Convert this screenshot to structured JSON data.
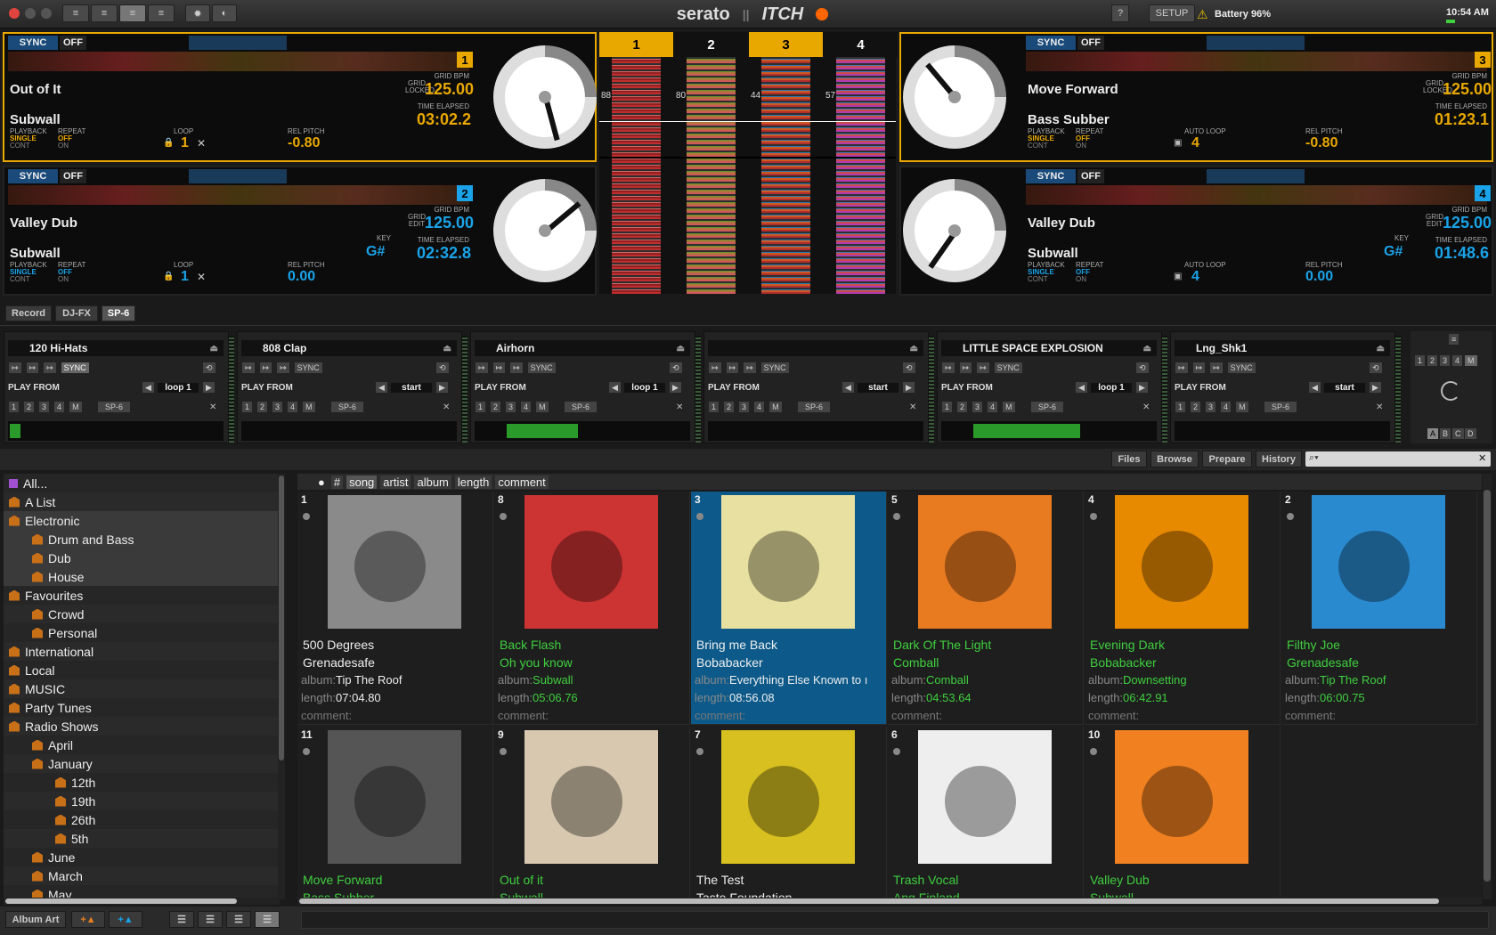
{
  "top": {
    "brand": "serato",
    "brand2": "ITCH",
    "help": "?",
    "setup": "SETUP",
    "battery": "Battery 96%",
    "time": "10:54 AM"
  },
  "decks": [
    {
      "no": "1",
      "sync": "SYNC",
      "off": "OFF",
      "title": "Out of It",
      "artist": "Subwall",
      "grid_lbl": "GRID LOCKED",
      "bpm_lbl": "GRID BPM",
      "bpm": "125.00",
      "time_lbl": "TIME ELAPSED",
      "time": "03:02.2",
      "playback_lbl": "PLAYBACK",
      "playback": "SINGLE",
      "playback2": "CONT",
      "repeat_lbl": "REPEAT",
      "repeat": "OFF",
      "repeat2": "ON",
      "loop_lbl": "LOOP",
      "loop": "1",
      "pitch_lbl": "REL PITCH",
      "pitch": "-0.80",
      "key_lbl": "",
      "key": ""
    },
    {
      "no": "2",
      "sync": "SYNC",
      "off": "OFF",
      "title": "Valley Dub",
      "artist": "Subwall",
      "grid_lbl": "GRID EDIT",
      "bpm_lbl": "GRID BPM",
      "bpm": "125.00",
      "time_lbl": "TIME ELAPSED",
      "time": "02:32.8",
      "playback_lbl": "PLAYBACK",
      "playback": "SINGLE",
      "playback2": "CONT",
      "repeat_lbl": "REPEAT",
      "repeat": "OFF",
      "repeat2": "ON",
      "loop_lbl": "LOOP",
      "loop": "1",
      "pitch_lbl": "REL PITCH",
      "pitch": "0.00",
      "key_lbl": "KEY",
      "key": "G#"
    },
    {
      "no": "3",
      "sync": "SYNC",
      "off": "OFF",
      "title": "Move Forward",
      "artist": "Bass Subber",
      "grid_lbl": "GRID LOCKED",
      "bpm_lbl": "GRID BPM",
      "bpm": "125.00",
      "time_lbl": "TIME ELAPSED",
      "time": "01:23.1",
      "playback_lbl": "PLAYBACK",
      "playback": "SINGLE",
      "playback2": "CONT",
      "repeat_lbl": "REPEAT",
      "repeat": "OFF",
      "repeat2": "ON",
      "loop_lbl": "AUTO LOOP",
      "loop": "4",
      "pitch_lbl": "REL PITCH",
      "pitch": "-0.80",
      "key_lbl": "",
      "key": ""
    },
    {
      "no": "4",
      "sync": "SYNC",
      "off": "OFF",
      "title": "Valley Dub",
      "artist": "Subwall",
      "grid_lbl": "GRID EDIT",
      "bpm_lbl": "GRID BPM",
      "bpm": "125.00",
      "time_lbl": "TIME ELAPSED",
      "time": "01:48.6",
      "playback_lbl": "PLAYBACK",
      "playback": "SINGLE",
      "playback2": "CONT",
      "repeat_lbl": "REPEAT",
      "repeat": "OFF",
      "repeat2": "ON",
      "loop_lbl": "AUTO LOOP",
      "loop": "4",
      "pitch_lbl": "REL PITCH",
      "pitch": "0.00",
      "key_lbl": "KEY",
      "key": "G#"
    }
  ],
  "center": {
    "cols": [
      "1",
      "2",
      "3",
      "4"
    ],
    "bpms": [
      "88",
      "80",
      "44",
      "57"
    ]
  },
  "tabs": [
    "Record",
    "DJ-FX",
    "SP-6"
  ],
  "samples": [
    {
      "name": "120 Hi-Hats",
      "play_from": "PLAY FROM",
      "mode": "loop 1",
      "sync": "SYNC",
      "sp": "SP-6"
    },
    {
      "name": "808 Clap",
      "play_from": "PLAY FROM",
      "mode": "start",
      "sync": "SYNC",
      "sp": "SP-6"
    },
    {
      "name": "Airhorn",
      "play_from": "PLAY FROM",
      "mode": "loop 1",
      "sync": "SYNC",
      "sp": "SP-6"
    },
    {
      "name": "",
      "play_from": "PLAY FROM",
      "mode": "start",
      "sync": "SYNC",
      "sp": "SP-6"
    },
    {
      "name": "LITTLE SPACE EXPLOSION",
      "play_from": "PLAY FROM",
      "mode": "loop 1",
      "sync": "SYNC",
      "sp": "SP-6"
    },
    {
      "name": "Lng_Shk1",
      "play_from": "PLAY FROM",
      "mode": "start",
      "sync": "SYNC",
      "sp": "SP-6"
    }
  ],
  "slots": [
    "1",
    "2",
    "3",
    "4",
    "M"
  ],
  "bank": [
    "A",
    "B",
    "C",
    "D"
  ],
  "library": {
    "buttons": [
      "Files",
      "Browse",
      "Prepare",
      "History"
    ],
    "columns": [
      "#",
      "song",
      "artist",
      "album",
      "length",
      "comment"
    ]
  },
  "crates": [
    {
      "label": "All...",
      "indent": 0
    },
    {
      "label": "A List",
      "indent": 0
    },
    {
      "label": "Electronic",
      "indent": 0
    },
    {
      "label": "Drum and Bass",
      "indent": 1
    },
    {
      "label": "Dub",
      "indent": 1
    },
    {
      "label": "House",
      "indent": 1
    },
    {
      "label": "Favourites",
      "indent": 0
    },
    {
      "label": "Crowd",
      "indent": 1
    },
    {
      "label": "Personal",
      "indent": 1
    },
    {
      "label": "International",
      "indent": 0
    },
    {
      "label": "Local",
      "indent": 0
    },
    {
      "label": "MUSIC",
      "indent": 0
    },
    {
      "label": "Party Tunes",
      "indent": 0
    },
    {
      "label": "Radio Shows",
      "indent": 0
    },
    {
      "label": "April",
      "indent": 1
    },
    {
      "label": "January",
      "indent": 1
    },
    {
      "label": "12th",
      "indent": 2
    },
    {
      "label": "19th",
      "indent": 2
    },
    {
      "label": "26th",
      "indent": 2
    },
    {
      "label": "5th",
      "indent": 2
    },
    {
      "label": "June",
      "indent": 1
    },
    {
      "label": "March",
      "indent": 1
    },
    {
      "label": "May",
      "indent": 1
    }
  ],
  "tracks": [
    {
      "num": "1",
      "song": "500 Degrees",
      "artist": "Grenadesafe",
      "album": "Tip The Roof",
      "length": "07:04.80",
      "color": "white",
      "art": "#8a8a8a"
    },
    {
      "num": "8",
      "song": "Back Flash",
      "artist": "Oh you know",
      "album": "Subwall",
      "length": "05:06.76",
      "color": "green",
      "art": "#c33"
    },
    {
      "num": "3",
      "song": "Bring me Back",
      "artist": "Bobabacker",
      "album": "Everything Else Known to ı",
      "length": "08:56.08",
      "color": "white",
      "art": "#e8e0a0",
      "selected": true
    },
    {
      "num": "5",
      "song": "Dark Of The Light",
      "artist": "Comball",
      "album": "Comball",
      "length": "04:53.64",
      "color": "green",
      "art": "#e87a20"
    },
    {
      "num": "4",
      "song": "Evening Dark",
      "artist": "Bobabacker",
      "album": "Downsetting",
      "length": "06:42.91",
      "color": "green",
      "art": "#e88a00"
    },
    {
      "num": "2",
      "song": "Filthy Joe",
      "artist": "Grenadesafe",
      "album": "Tip The Roof",
      "length": "06:00.75",
      "color": "green",
      "art": "#2a8ad0"
    },
    {
      "num": "11",
      "song": "Move Forward",
      "artist": "Bass Subber",
      "album": "",
      "length": "",
      "color": "green",
      "art": "#555"
    },
    {
      "num": "9",
      "song": "Out of it",
      "artist": "Subwall",
      "album": "",
      "length": "",
      "color": "green",
      "art": "#d8c8b0"
    },
    {
      "num": "7",
      "song": "The Test",
      "artist": "Taste Foundation",
      "album": "",
      "length": "",
      "color": "white",
      "art": "#d8c020"
    },
    {
      "num": "6",
      "song": "Trash Vocal",
      "artist": "Ang Finland",
      "album": "",
      "length": "",
      "color": "green",
      "art": "#eee"
    },
    {
      "num": "10",
      "song": "Valley Dub",
      "artist": "Subwall",
      "album": "",
      "length": "",
      "color": "green",
      "art": "#f08020"
    }
  ],
  "field_labels": {
    "album": "album:",
    "length": "length:",
    "comment": "comment:"
  },
  "bottom": {
    "album_art": "Album Art"
  },
  "colors": {
    "active": "#e8a800",
    "blue": "#1aa3e8",
    "green": "#3fcf3f",
    "selected": "#0d5a8a"
  }
}
